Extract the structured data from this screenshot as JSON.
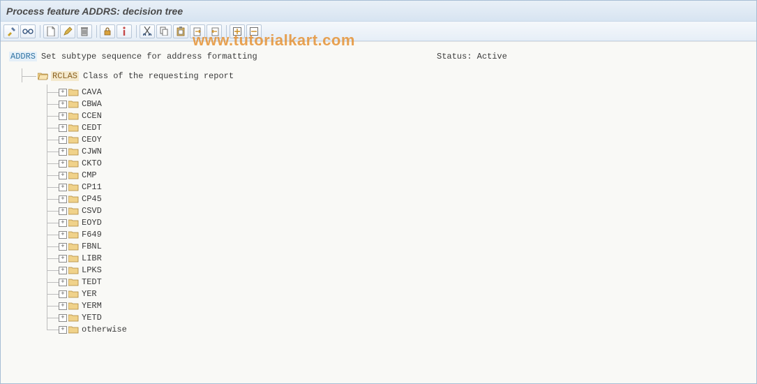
{
  "title": "Process feature ADDRS: decision tree",
  "watermark": "www.tutorialkart.com",
  "toolbar": {
    "g1": [
      "pencil-wrench",
      "glasses"
    ],
    "g2": [
      "page",
      "edit-pencil",
      "trash"
    ],
    "g3": [
      "lock",
      "info"
    ],
    "g4": [
      "cut",
      "copy",
      "paste",
      "clipboard-in",
      "clipboard-out"
    ],
    "g5": [
      "expand-all",
      "collapse-all"
    ]
  },
  "tree": {
    "root": {
      "code": "ADDRS",
      "desc": "Set subtype sequence for address formatting",
      "status_label": "Status:",
      "status_value": "Active"
    },
    "branch": {
      "code": "RCLAS",
      "desc": "Class of the requesting report"
    },
    "leaves": [
      "CAVA",
      "CBWA",
      "CCEN",
      "CEDT",
      "CEOY",
      "CJWN",
      "CKTO",
      "CMP",
      "CP11",
      "CP45",
      "CSVD",
      "EOYD",
      "F649",
      "FBNL",
      "LIBR",
      "LPKS",
      "TEDT",
      "YER",
      "YERM",
      "YETD",
      "otherwise"
    ]
  }
}
